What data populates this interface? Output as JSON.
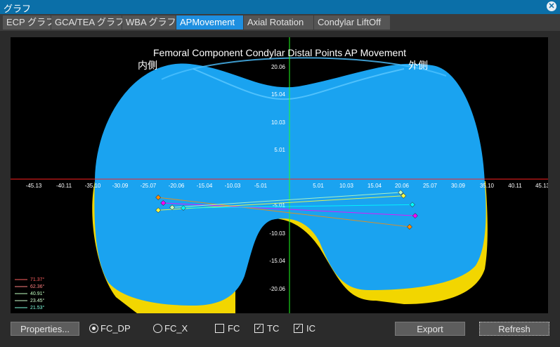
{
  "window": {
    "title": "グラフ",
    "close_icon": "close-icon"
  },
  "tabs": [
    {
      "label": "ECP グラフ"
    },
    {
      "label": "GCA/TEA グラフ"
    },
    {
      "label": "WBA グラフ"
    },
    {
      "label": "APMovement",
      "active": true
    },
    {
      "label": "Axial Rotation"
    },
    {
      "label": "Condylar LiftOff"
    }
  ],
  "chart": {
    "title": "Femoral Component Condylar Distal Points AP Movement",
    "medial_label": "内側",
    "lateral_label": "外側",
    "x_ticks": [
      "-45.13",
      "-40.11",
      "-35.10",
      "-30.09",
      "-25.07",
      "-20.06",
      "-15.04",
      "-10.03",
      "-5.01",
      "5.01",
      "10.03",
      "15.04",
      "20.06",
      "25.07",
      "30.09",
      "35.10",
      "40.11",
      "45.13"
    ],
    "y_ticks": [
      "20.06",
      "15.04",
      "10.03",
      "5.01",
      "-5.01",
      "-10.03",
      "-15.04",
      "-20.06"
    ],
    "legend": [
      "71.37°",
      "62.36°",
      "40.91°",
      "23.45°",
      "21.53°"
    ],
    "colors": {
      "implant": "#1aa3f0",
      "x_axis": "#ff2020",
      "y_axis": "#20ff20",
      "bone": "#f2d600"
    }
  },
  "chart_data": {
    "type": "scatter",
    "xlim": [
      -47,
      47
    ],
    "ylim": [
      -24.5,
      24.5
    ],
    "series": [
      {
        "name": "71.37°",
        "color": "#ff8c00",
        "x": [
          -23.5,
          21.5
        ],
        "y": [
          -3.3,
          -8.6
        ]
      },
      {
        "name": "62.36°",
        "color": "#ff00ff",
        "x": [
          -22.6,
          22.5
        ],
        "y": [
          -4.3,
          -6.6
        ]
      },
      {
        "name": "40.91°",
        "color": "#ffff40",
        "x": [
          -23.5,
          20.4
        ],
        "y": [
          -5.6,
          -3.0
        ]
      },
      {
        "name": "23.45°",
        "color": "#c0ffc0",
        "x": [
          -21.0,
          19.9
        ],
        "y": [
          -5.1,
          -2.4
        ]
      },
      {
        "name": "21.53°",
        "color": "#00ffff",
        "x": [
          -19.0,
          22.0
        ],
        "y": [
          -5.2,
          -4.6
        ]
      }
    ]
  },
  "bottom": {
    "properties_label": "Properties...",
    "radio_fc_dp": "FC_DP",
    "radio_fc_x": "FC_X",
    "chk_fc": "FC",
    "chk_tc": "TC",
    "chk_ic": "IC",
    "export_label": "Export",
    "refresh_label": "Refresh"
  }
}
